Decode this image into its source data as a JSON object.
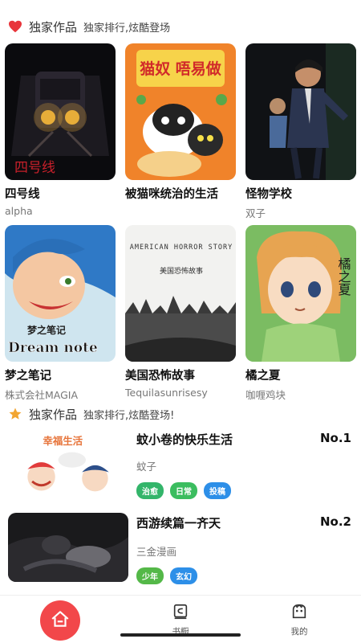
{
  "section1": {
    "title": "独家作品",
    "subtitle": "独家排行,炫酷登场",
    "icon": "heart-icon",
    "icon_color": "#e8353b"
  },
  "cards": [
    {
      "name": "四号线",
      "author": "alpha"
    },
    {
      "name": "被猫咪统治的生活",
      "author": ""
    },
    {
      "name": "怪物学校",
      "author": "双子"
    },
    {
      "name": "梦之笔记",
      "author": "株式会社MAGIA"
    },
    {
      "name": "美国恐怖故事",
      "author": "Tequilasunrisesy"
    },
    {
      "name": "橘之夏",
      "author": "咖喱鸡块"
    }
  ],
  "covers": {
    "c1_text": "四号线",
    "c2_text": "猫奴 唔易做",
    "c4_text1": "梦之笔记",
    "c4_text2": "Dream note",
    "c5_text1": "AMERICAN HORROR STORY",
    "c5_text2": "美国恐怖故事",
    "c6_text": "橘之夏"
  },
  "section2": {
    "title": "独家作品",
    "subtitle": "独家排行,炫酷登场!",
    "icon": "star-icon",
    "icon_color": "#f2a531"
  },
  "ranking": [
    {
      "title": "蚊小卷的快乐生活",
      "rank": "No.1",
      "author": "蚊子",
      "thumb_text": "幸福生活",
      "tags": [
        {
          "label": "治愈",
          "color": "#33b56a"
        },
        {
          "label": "日常",
          "color": "#3bbd5f"
        },
        {
          "label": "投稿",
          "color": "#2d8fe8"
        }
      ]
    },
    {
      "title": "西游续篇一齐天",
      "rank": "No.2",
      "author": "三金漫画",
      "thumb_text": "",
      "tags": [
        {
          "label": "少年",
          "color": "#54b848"
        },
        {
          "label": "玄幻",
          "color": "#2d8fe8"
        }
      ]
    }
  ],
  "tabbar": {
    "home_icon": "home-icon",
    "bookshelf_label": "书橱",
    "mine_label": "我的",
    "accent": "#f2474a"
  }
}
